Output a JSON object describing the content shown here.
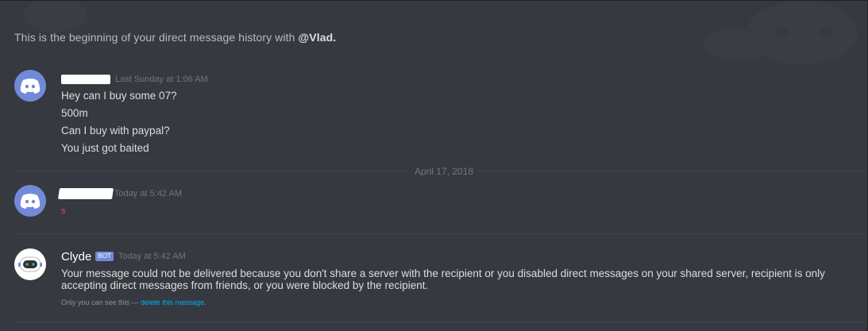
{
  "intro": {
    "prefix": "This is the beginning of your direct message history with ",
    "handle": "@Vlad",
    "suffix": "."
  },
  "messages": {
    "first": {
      "timestamp": "Last Sunday at 1:06 AM",
      "lines": [
        "Hey can I buy some 07?",
        "500m",
        "Can I buy with paypal?",
        "You just got baited"
      ]
    },
    "divider_date": "April 17, 2018",
    "second": {
      "timestamp": "Today at 5:42 AM",
      "lines": [
        "s"
      ]
    },
    "clyde": {
      "username": "Clyde",
      "bot_tag": "BOT",
      "timestamp": "Today at 5:42 AM",
      "text": "Your message could not be delivered because you don't share a server with the recipient or you disabled direct messages on your shared server, recipient is only accepting direct messages from friends, or you were blocked by the recipient.",
      "ephemeral_prefix": "Only you can see this — ",
      "ephemeral_link": "delete this message",
      "ephemeral_suffix": "."
    }
  },
  "colors": {
    "background": "#36393f",
    "blurple": "#7289da",
    "link": "#00b0f4",
    "danger": "#f04747"
  },
  "icons": {
    "default_avatar": "discord-logo-icon",
    "clyde_avatar": "clyde-robot-icon"
  }
}
